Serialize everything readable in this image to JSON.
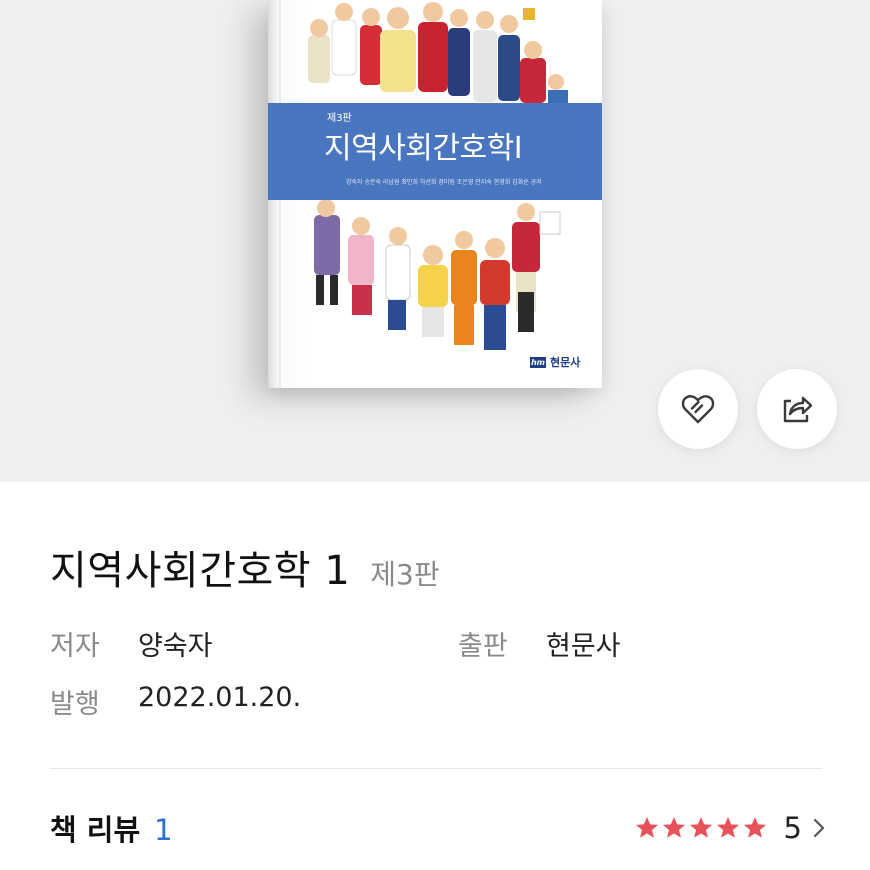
{
  "cover": {
    "edition": "제3판",
    "title": "지역사회간호학Ⅰ",
    "authors": "양숙자 송문숙 라남원 최민희 하선희 장미림 조은영 안지숙 한영희 김화순 공저",
    "publisher_logo": "hm",
    "publisher": "현문사",
    "band_color": "#4a76bf"
  },
  "actions": {
    "like_icon": "heart-icon",
    "share_icon": "share-icon"
  },
  "book": {
    "title": "지역사회간호학 1",
    "edition": "제3판",
    "author_label": "저자",
    "author": "양숙자",
    "publisher_label": "출판",
    "publisher": "현문사",
    "date_label": "발행",
    "date": "2022.01.20."
  },
  "review": {
    "label": "책 리뷰",
    "count": "1",
    "stars": 5,
    "rating": "5",
    "star_color": "#e8525a",
    "count_color": "#2f6fd6",
    "chevron_icon": "chevron-right-icon"
  }
}
